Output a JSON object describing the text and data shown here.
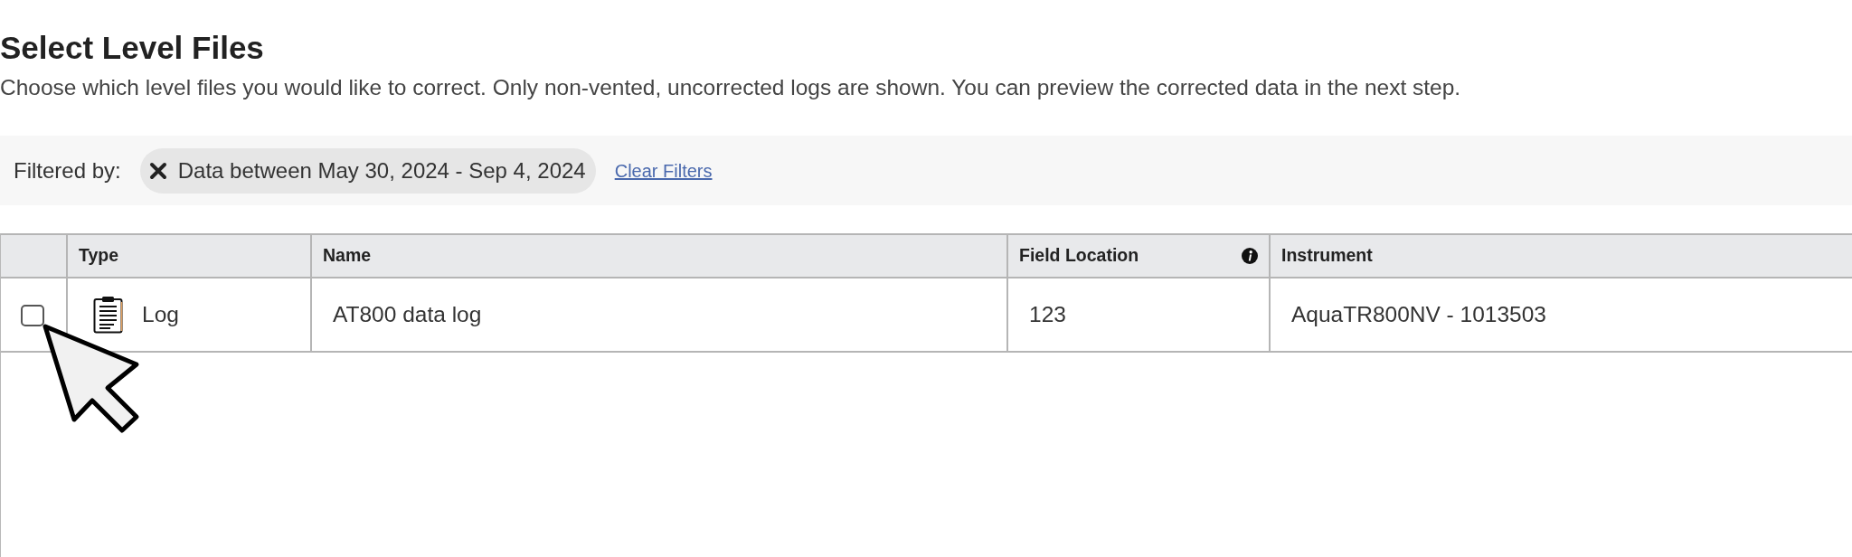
{
  "header": {
    "title": "Select Level Files",
    "description": "Choose which level files you would like to correct. Only non-vented, uncorrected logs are shown. You can preview the corrected data in the next step."
  },
  "filter_bar": {
    "label": "Filtered by:",
    "chips": [
      {
        "label": "Data between May 30, 2024 - Sep 4, 2024"
      }
    ],
    "clear_link": "Clear Filters"
  },
  "table": {
    "columns": [
      {
        "label": "Type",
        "info_icon": false
      },
      {
        "label": "Name",
        "info_icon": false
      },
      {
        "label": "Field Location",
        "info_icon": true
      },
      {
        "label": "Instrument",
        "info_icon": false
      }
    ],
    "rows": [
      {
        "checked": false,
        "type": "Log",
        "name": "AT800 data log",
        "field_location": "123",
        "instrument": "AquaTR800NV - 1013503"
      }
    ]
  },
  "pointer": {
    "shown": true
  }
}
